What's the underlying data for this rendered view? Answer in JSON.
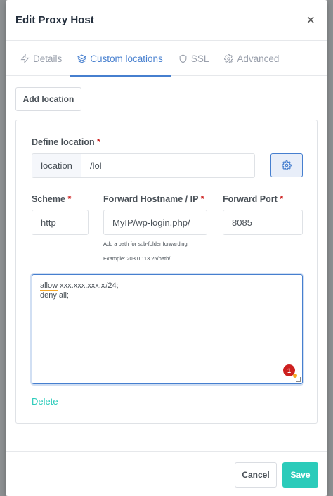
{
  "modal": {
    "title": "Edit Proxy Host",
    "close_glyph": "×"
  },
  "tabs": [
    {
      "label": "Details",
      "icon": "bolt-icon",
      "active": false
    },
    {
      "label": "Custom locations",
      "icon": "layers-icon",
      "active": true
    },
    {
      "label": "SSL",
      "icon": "shield-icon",
      "active": false
    },
    {
      "label": "Advanced",
      "icon": "gear-icon",
      "active": false
    }
  ],
  "add_location_label": "Add location",
  "location": {
    "label": "Define location",
    "required_mark": "*",
    "prefix": "location",
    "value": "/lol"
  },
  "scheme": {
    "label": "Scheme",
    "required_mark": "*",
    "value": "http"
  },
  "forward_hostname": {
    "label": "Forward Hostname / IP",
    "required_mark": "*",
    "value": "MyIP/wp-login.php/",
    "hint_line1": "Add a path for sub-folder forwarding.",
    "hint_line2": "Example: 203.0.113.25/path/"
  },
  "forward_port": {
    "label": "Forward Port",
    "required_mark": "*",
    "value": "8085"
  },
  "advanced_config": {
    "line1_word": "allow",
    "line1_rest_a": " xxx.xxx.xxx.x",
    "line1_rest_b": "/24;",
    "line2": "deny all;",
    "issue_count": "1"
  },
  "delete_label": "Delete",
  "footer": {
    "cancel_label": "Cancel",
    "save_label": "Save"
  },
  "colors": {
    "accent": "#467fcf",
    "teal": "#2bcbba",
    "danger": "#cd201f"
  }
}
